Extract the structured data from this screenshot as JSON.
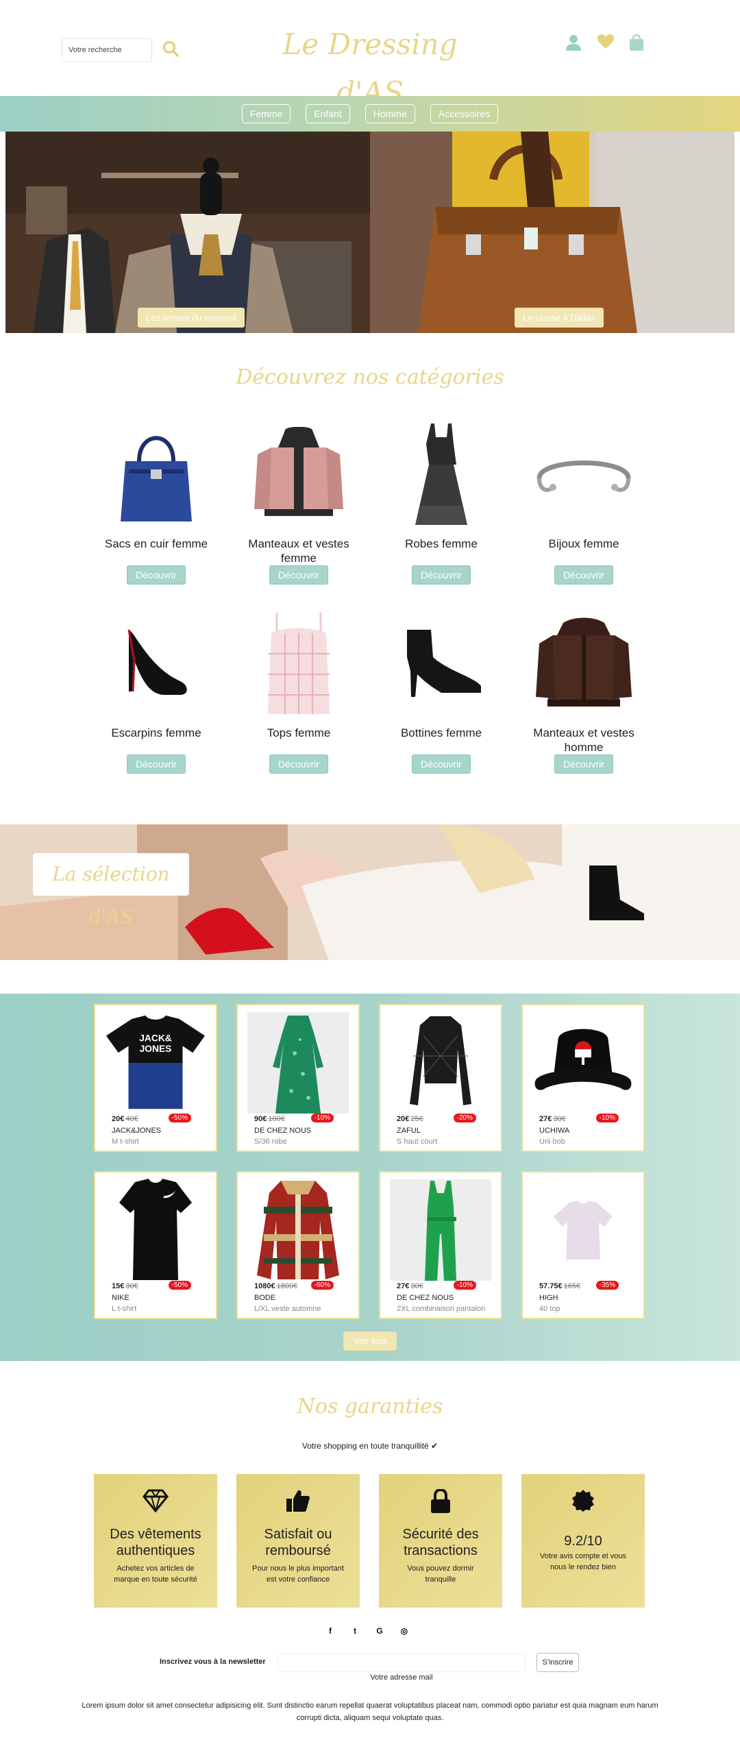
{
  "header": {
    "search_placeholder": "Votre recherche",
    "logo": "Le Dressing d'AS"
  },
  "nav": [
    "Femme",
    "Enfant",
    "Homme",
    "Accessoires"
  ],
  "hero": {
    "left_label": "Les tenues du moment",
    "right_label": "Le classe à Dallas"
  },
  "categories_title": "Découvrez nos catégories",
  "categories": [
    {
      "name": "Sacs en cuir femme",
      "button": "Découvrir",
      "icon": "handbag-icon"
    },
    {
      "name": "Manteaux et vestes femme",
      "button": "Découvrir",
      "icon": "jacket-icon"
    },
    {
      "name": "Robes femme",
      "button": "Découvrir",
      "icon": "dress-icon"
    },
    {
      "name": "Bijoux femme",
      "button": "Découvrir",
      "icon": "bracelet-icon"
    },
    {
      "name": "Escarpins femme",
      "button": "Découvrir",
      "icon": "heel-icon"
    },
    {
      "name": "Tops femme",
      "button": "Découvrir",
      "icon": "top-icon"
    },
    {
      "name": "Bottines femme",
      "button": "Découvrir",
      "icon": "boot-icon"
    },
    {
      "name": "Manteaux et vestes homme",
      "button": "Découvrir",
      "icon": "leather-jacket-icon"
    }
  ],
  "selection_banner": "La sélection d'AS",
  "products": [
    {
      "price": "20€",
      "old": "40€",
      "discount": "-50%",
      "brand": "JACK&JONES",
      "desc": "M t-shirt"
    },
    {
      "price": "90€",
      "old": "100€",
      "discount": "-10%",
      "brand": "DE CHEZ NOUS",
      "desc": "S/36 robe"
    },
    {
      "price": "20€",
      "old": "25€",
      "discount": "-20%",
      "brand": "ZAFUL",
      "desc": "S haut court"
    },
    {
      "price": "27€",
      "old": "30€",
      "discount": "-10%",
      "brand": "UCHIWA",
      "desc": "Uni bob"
    },
    {
      "price": "15€",
      "old": "30€",
      "discount": "-50%",
      "brand": "NIKE",
      "desc": "L t-shirt"
    },
    {
      "price": "1080€",
      "old": "1800€",
      "discount": "-60%",
      "brand": "BODE",
      "desc": "L/XL veste automne"
    },
    {
      "price": "27€",
      "old": "30€",
      "discount": "-10%",
      "brand": "DE CHEZ NOUS",
      "desc": "2XL combinaison pantalon"
    },
    {
      "price": "57.75€",
      "old": "165€",
      "discount": "-35%",
      "brand": "HIGH",
      "desc": "40 top"
    }
  ],
  "see_all": "Voir tout",
  "guarantees_title": "Nos garanties",
  "guarantees_subtitle": "Votre shopping en toute tranquillité ✔",
  "guarantees": [
    {
      "title": "Des vêtements authentiques",
      "text": "Achetez vos articles de marque en toute sécurité",
      "icon": "diamond-icon"
    },
    {
      "title": "Satisfait ou remboursé",
      "text": "Pour nous le plus important est votre confiance",
      "icon": "thumbs-up-icon"
    },
    {
      "title": "Sécurité des transactions",
      "text": "Vous pouvez dormir tranquille",
      "icon": "lock-icon"
    },
    {
      "title": "9.2/10",
      "text": "Votre avis compte et vous nous le rendez bien",
      "icon": "badge-icon"
    }
  ],
  "social": [
    "f",
    "t",
    "G",
    "◎"
  ],
  "newsletter": {
    "label": "Inscrivez vous à la newsletter",
    "button": "S'inscrire",
    "help": "Votre adresse mail"
  },
  "footer_text": "Lorem ipsum dolor sit amet consectetur adipisicing elit. Sunt distinctio earum repellat quaerat voluptatibus placeat nam, commodi optio pariatur est quia magnam eum harum corrupti dicta, aliquam sequi voluptate quas."
}
